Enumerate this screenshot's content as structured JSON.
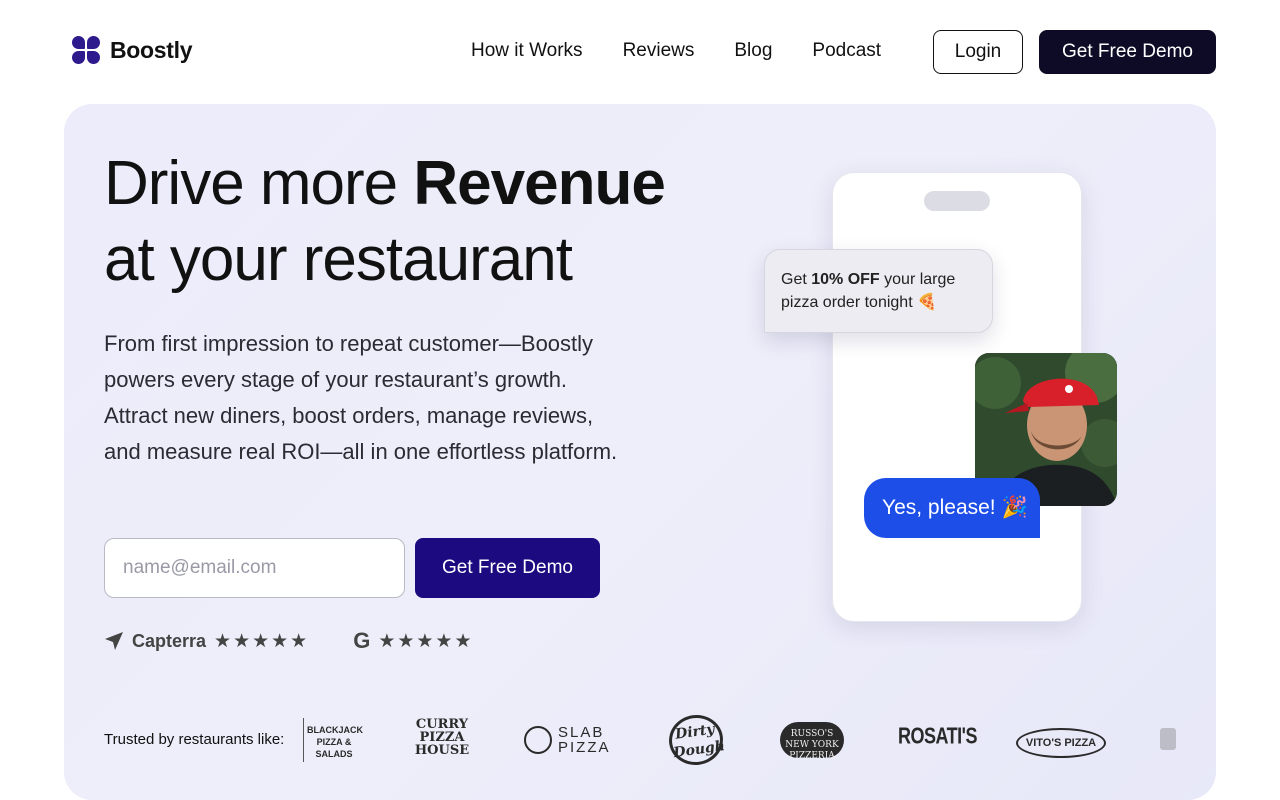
{
  "brand": {
    "name": "Boostly"
  },
  "nav": {
    "links": [
      "How it Works",
      "Reviews",
      "Blog",
      "Podcast"
    ],
    "login_label": "Login",
    "demo_label": "Get Free Demo"
  },
  "hero": {
    "headline_prefix": "Drive more ",
    "headline_bold": "Revenue",
    "headline_line2": "at your restaurant",
    "subcopy": "From first impression to repeat customer—Boostly powers every stage of your restaurant’s growth. Attract new diners, boost orders, manage reviews, and measure real ROI—all in one effortless platform.",
    "email_placeholder": "name@email.com",
    "cta_label": "Get Free Demo",
    "ratings": [
      {
        "label": "Capterra",
        "stars": "★★★★★",
        "icon": "capterra-arrow-icon"
      },
      {
        "label": "G",
        "stars": "★★★★★",
        "icon": "google-icon"
      }
    ]
  },
  "phone_mock": {
    "offer_prefix": "Get ",
    "offer_bold": "10% OFF",
    "offer_suffix": " your large pizza order tonight 🍕",
    "reply": "Yes, please! 🎉"
  },
  "trusted": {
    "label": "Trusted by restaurants like:",
    "logos": [
      "BLACKJACK PIZZA & SALADS",
      "CURRY PIZZA HOUSE",
      "SLAB PIZZA",
      "Dirty Dough",
      "RUSSO'S NEW YORK PIZZERIA",
      "ROSATI'S",
      "VITO'S PIZZA AND SUBS"
    ]
  }
}
